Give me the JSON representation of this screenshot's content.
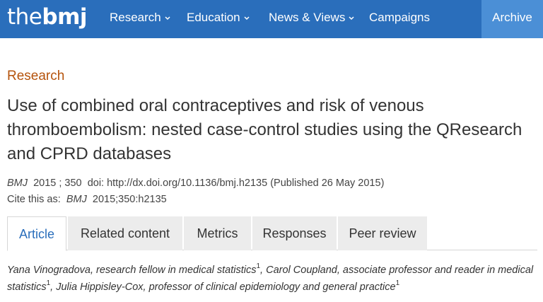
{
  "nav": {
    "logo_thin": "the",
    "logo_bold": "bmj",
    "items": [
      {
        "label": "Research",
        "has_dropdown": true
      },
      {
        "label": "Education",
        "has_dropdown": true
      },
      {
        "label": "News & Views",
        "has_dropdown": true
      },
      {
        "label": "Campaigns",
        "has_dropdown": false
      }
    ],
    "archive_label": "Archive",
    "colors": {
      "bar": "#2a6ebb",
      "archive": "#4b8fd6"
    }
  },
  "article": {
    "section": "Research",
    "title": "Use of combined oral contraceptives and risk of venous thromboembolism: nested case-control studies using the QResearch and CPRD databases",
    "journal": "BMJ",
    "year": "2015",
    "separator": ";",
    "volume": "350",
    "doi": "doi: http://dx.doi.org/10.1136/bmj.h2135",
    "published": "(Published 26 May 2015)",
    "cite_prefix": "Cite this as:",
    "cite_journal": "BMJ",
    "cite_ref": "2015;350:h2135"
  },
  "tabs": [
    {
      "label": "Article",
      "active": true
    },
    {
      "label": "Related content",
      "active": false
    },
    {
      "label": "Metrics",
      "active": false
    },
    {
      "label": "Responses",
      "active": false
    },
    {
      "label": "Peer review",
      "active": false
    }
  ],
  "authors": [
    {
      "text": "Yana Vinogradova, research fellow in medical statistics",
      "sup": "1",
      "sep": ","
    },
    {
      "text": "Carol Coupland, associate professor and reader in medical statistics",
      "sup": "1",
      "sep": ","
    },
    {
      "text": "Julia Hippisley-Cox, professor of clinical epidemiology and general practice",
      "sup": "1",
      "sep": ""
    }
  ],
  "accent_color": "#b5530c"
}
